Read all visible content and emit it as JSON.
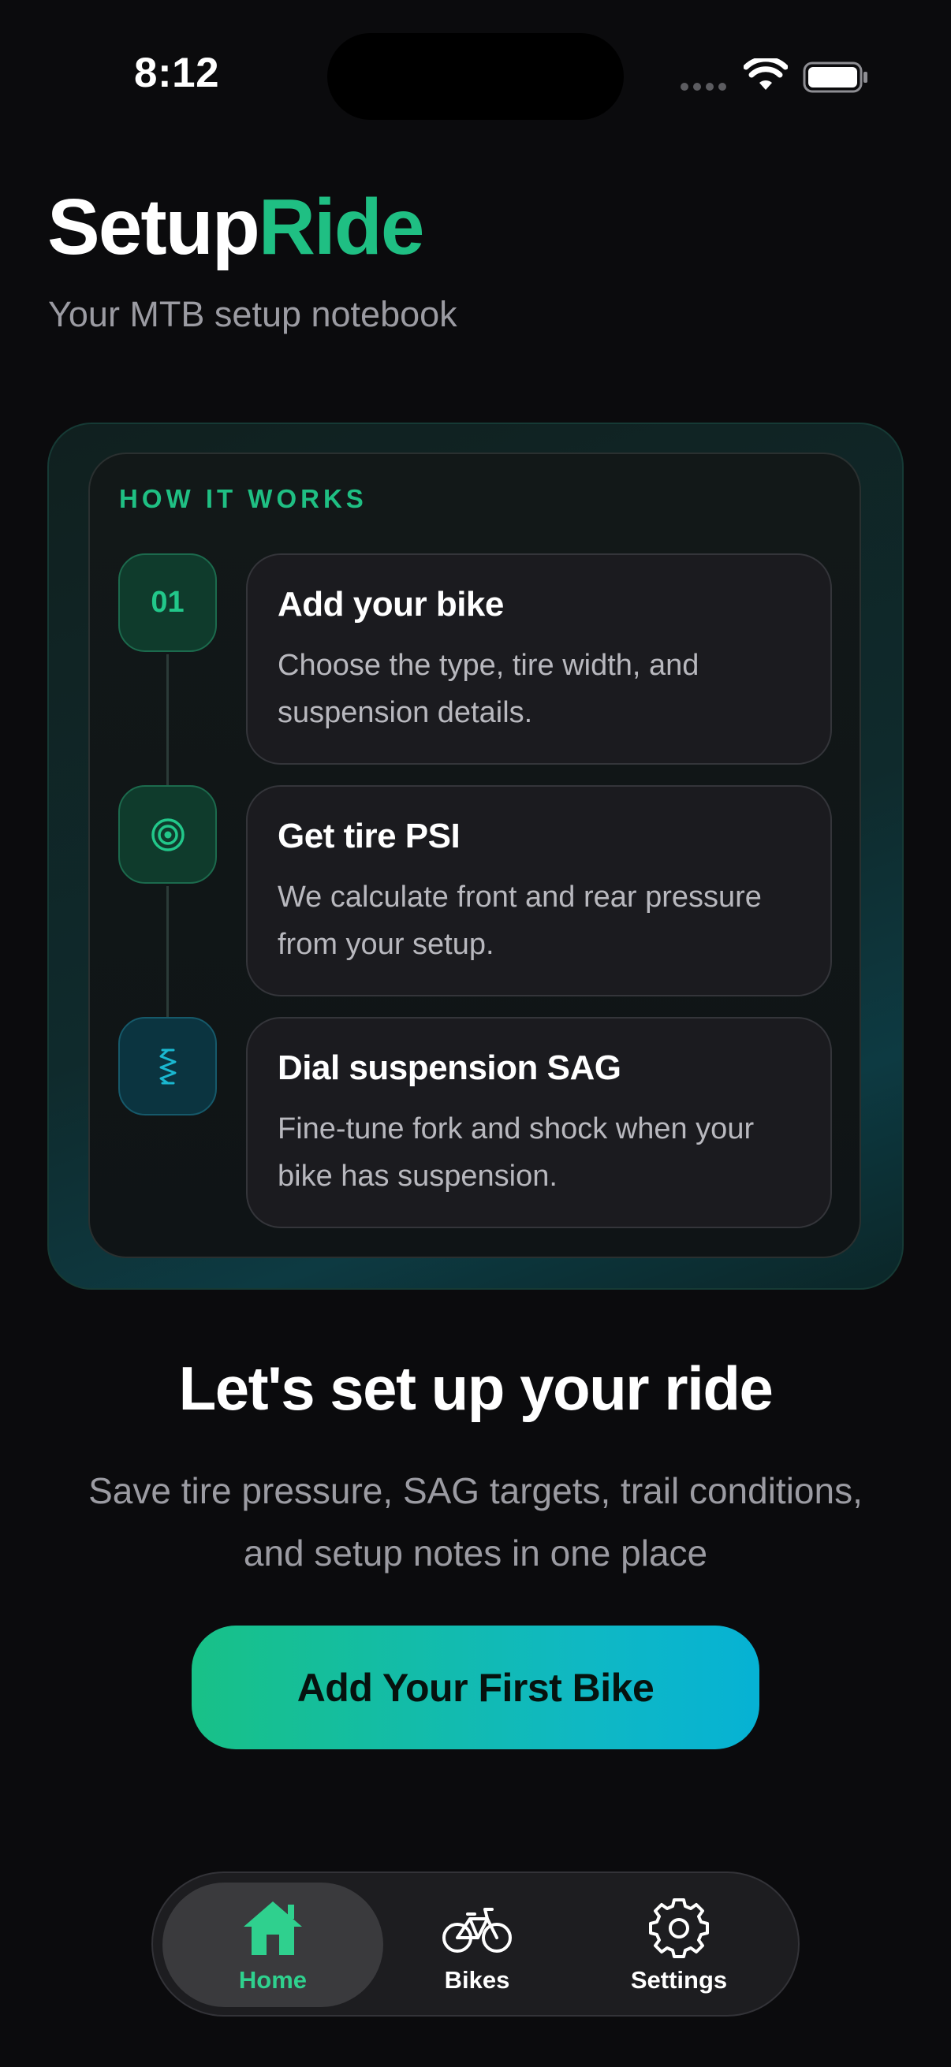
{
  "status_bar": {
    "time": "8:12"
  },
  "header": {
    "title_part1": "Setup",
    "title_part2": "Ride",
    "subtitle": "Your MTB setup notebook"
  },
  "how_it_works": {
    "heading": "HOW IT WORKS",
    "steps": [
      {
        "badge": "01",
        "badge_icon": "number-badge",
        "title": "Add your bike",
        "description": "Choose the type, tire width, and suspension details."
      },
      {
        "badge": "",
        "badge_icon": "target-icon",
        "title": "Get tire PSI",
        "description": "We calculate front and rear pressure from your setup."
      },
      {
        "badge": "",
        "badge_icon": "spring-icon",
        "title": "Dial suspension SAG",
        "description": "Fine-tune fork and shock when your bike has suspension."
      }
    ]
  },
  "hero": {
    "title": "Let's set up your ride",
    "description": "Save tire pressure, SAG targets, trail conditions, and setup notes in one place"
  },
  "cta": {
    "label": "Add Your First Bike"
  },
  "tab_bar": {
    "tabs": [
      {
        "label": "Home",
        "icon": "home-icon",
        "active": true
      },
      {
        "label": "Bikes",
        "icon": "bicycle-icon",
        "active": false
      },
      {
        "label": "Settings",
        "icon": "gear-icon",
        "active": false
      }
    ]
  },
  "colors": {
    "background": "#0b0b0d",
    "accent_green": "#1fbf83",
    "accent_teal": "#06b2d4",
    "muted_text": "#9b9ba2"
  }
}
